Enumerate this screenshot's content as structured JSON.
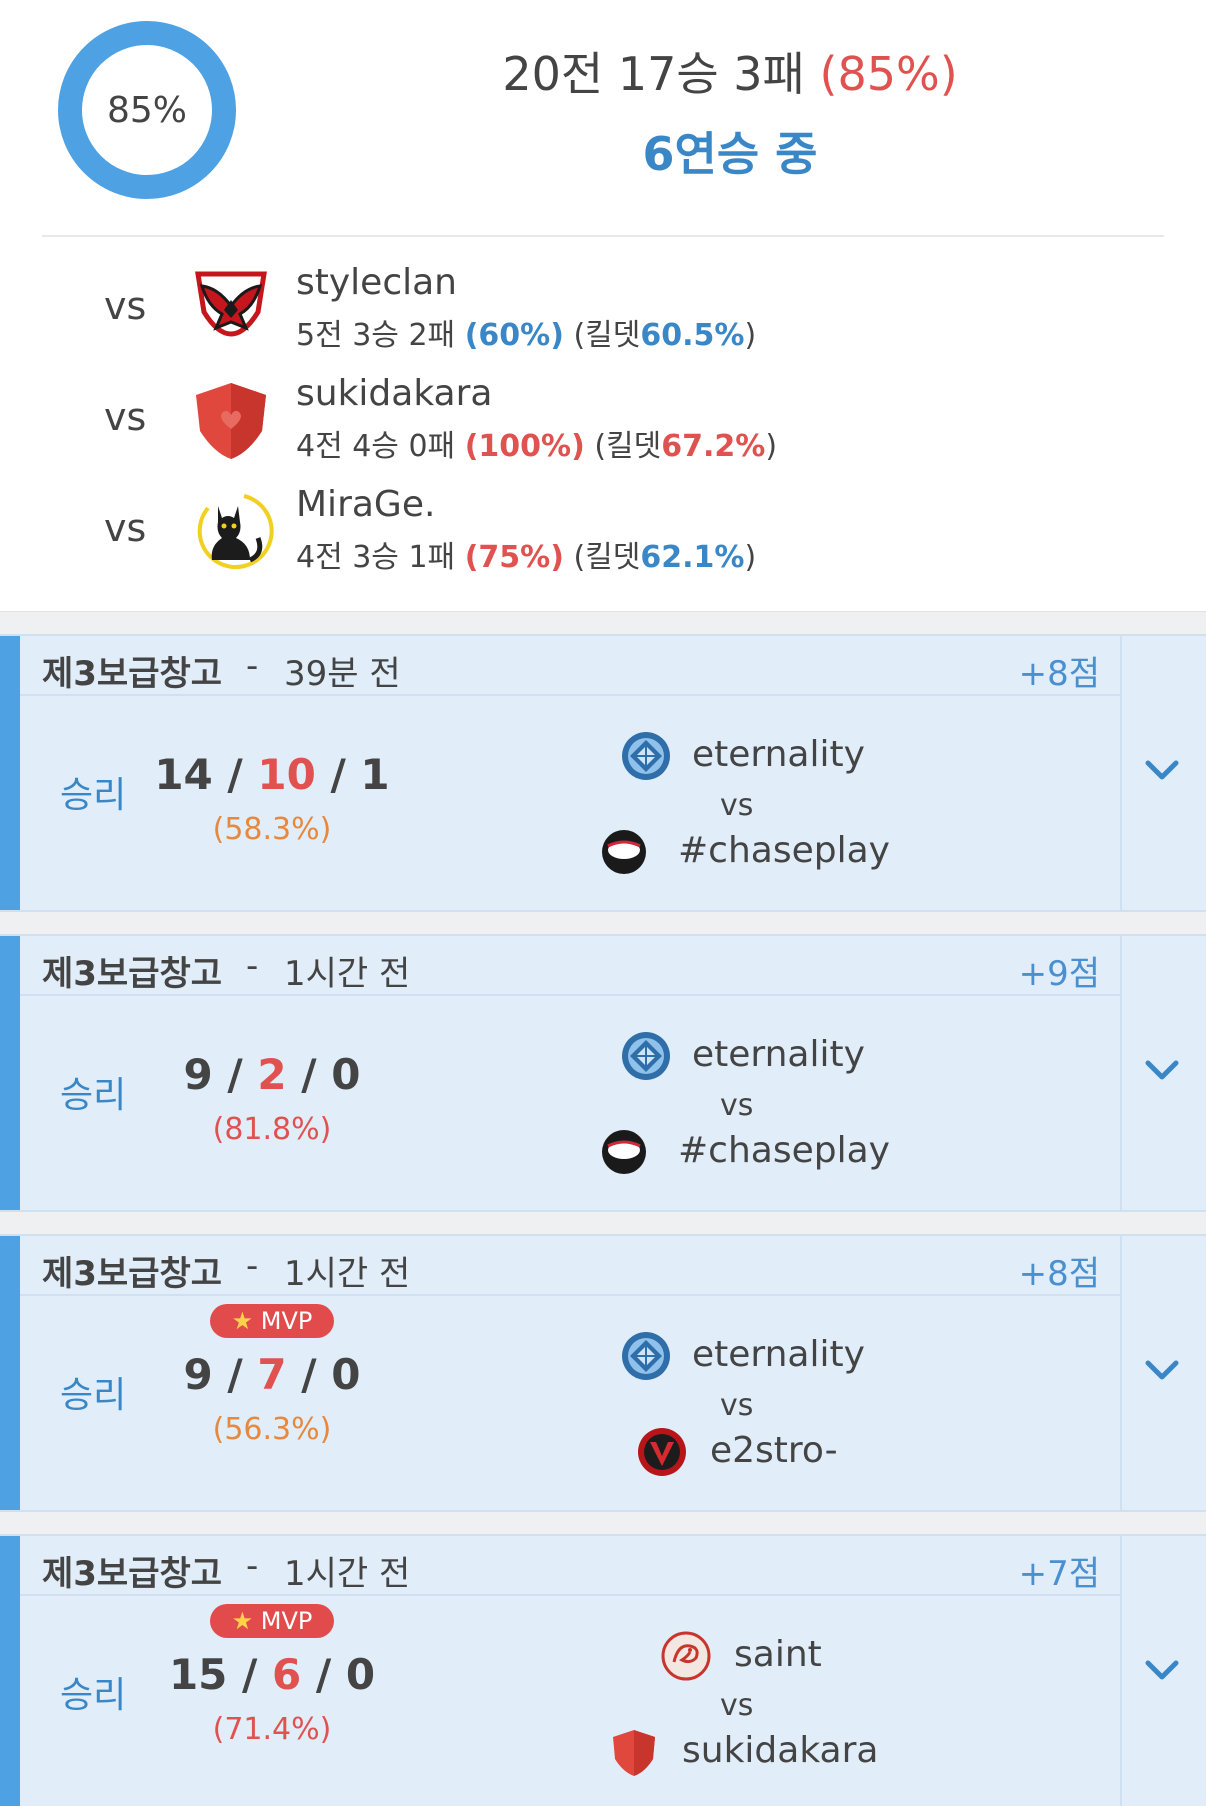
{
  "summary": {
    "win_rate_value": 85,
    "win_rate_label": "85%",
    "record_text": "20전 17승 3패",
    "record_rate": "(85%)",
    "streak": "6연승 중",
    "colors": {
      "win": "#4ea1e3",
      "loss": "#e05a50"
    }
  },
  "opponents": [
    {
      "vs": "vs",
      "logo": "phoenix-clan-logo",
      "name": "styleclan",
      "record": "5전 3승 2패",
      "rate": "(60%)",
      "kd_label": "(킬뎃",
      "kd": "60.5%",
      "kd_close": ")"
    },
    {
      "vs": "vs",
      "logo": "red-shield-logo",
      "name": "sukidakara",
      "record": "4전 4승 0패",
      "rate": "(100%)",
      "kd_label": "(킬뎃",
      "kd": "67.2%",
      "kd_close": ")"
    },
    {
      "vs": "vs",
      "logo": "black-cat-logo",
      "name": "MiraGe.",
      "record": "4전 3승 1패",
      "rate": "(75%)",
      "kd_label": "(킬뎃",
      "kd": "62.1%",
      "kd_close": ")"
    }
  ],
  "matches": [
    {
      "map": "제3보급창고",
      "sep": "-",
      "time": "39분 전",
      "points": "+8점",
      "result": "승리",
      "mvp": false,
      "kills": "14",
      "deaths": "10",
      "assists": "1",
      "slash": "/",
      "pct": "(58.3%)",
      "team1": {
        "name": "eternality",
        "logo": "blue-crest-logo"
      },
      "vs": "vs",
      "team2": {
        "name": "#chaseplay",
        "logo": "black-mask-logo"
      }
    },
    {
      "map": "제3보급창고",
      "sep": "-",
      "time": "1시간 전",
      "points": "+9점",
      "result": "승리",
      "mvp": false,
      "kills": "9",
      "deaths": "2",
      "assists": "0",
      "slash": "/",
      "pct": "(81.8%)",
      "team1": {
        "name": "eternality",
        "logo": "blue-crest-logo"
      },
      "vs": "vs",
      "team2": {
        "name": "#chaseplay",
        "logo": "black-mask-logo"
      }
    },
    {
      "map": "제3보급창고",
      "sep": "-",
      "time": "1시간 전",
      "points": "+8점",
      "result": "승리",
      "mvp": true,
      "mvp_label": "MVP",
      "kills": "9",
      "deaths": "7",
      "assists": "0",
      "slash": "/",
      "pct": "(56.3%)",
      "team1": {
        "name": "eternality",
        "logo": "blue-crest-logo"
      },
      "vs": "vs",
      "team2": {
        "name": "e2stro-",
        "logo": "red-v-logo"
      }
    },
    {
      "map": "제3보급창고",
      "sep": "-",
      "time": "1시간 전",
      "points": "+7점",
      "result": "승리",
      "mvp": true,
      "mvp_label": "MVP",
      "kills": "15",
      "deaths": "6",
      "assists": "0",
      "slash": "/",
      "pct": "(71.4%)",
      "team1": {
        "name": "saint",
        "logo": "dragon-emblem-logo"
      },
      "vs": "vs",
      "team2": {
        "name": "sukidakara",
        "logo": "red-shield-logo"
      }
    }
  ]
}
